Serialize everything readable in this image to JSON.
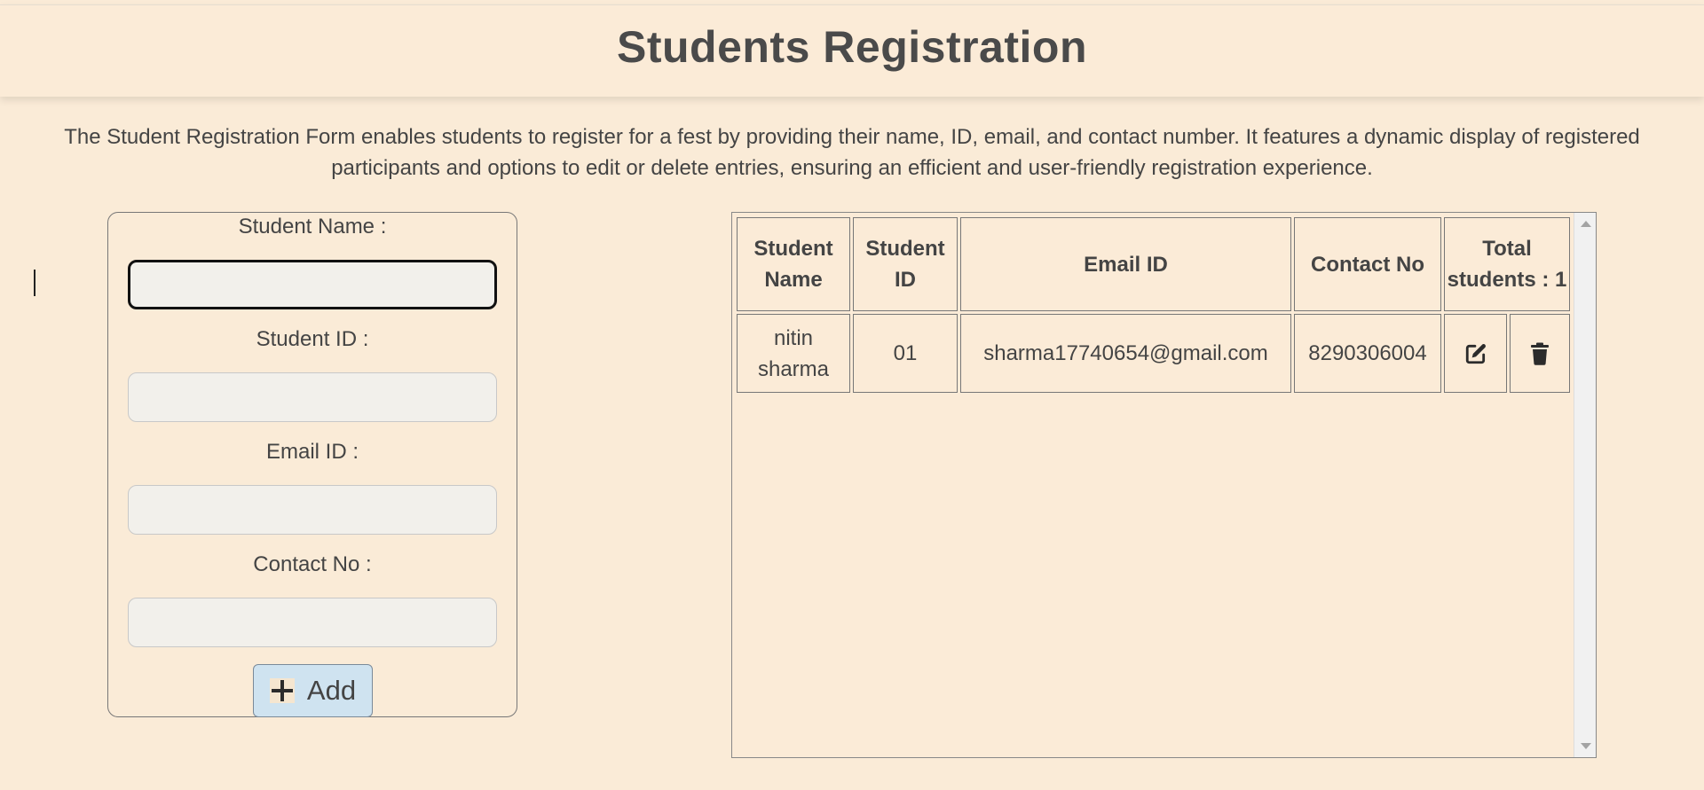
{
  "header": {
    "title": "Students Registration"
  },
  "description": "The Student Registration Form enables students to register for a fest by providing their name, ID, email, and contact number. It features a dynamic display of registered participants and options to edit or delete entries, ensuring an efficient and user-friendly registration experience.",
  "form": {
    "fields": [
      {
        "label": "Student Name :",
        "value": "",
        "placeholder": ""
      },
      {
        "label": "Student ID :",
        "value": "",
        "placeholder": ""
      },
      {
        "label": "Email ID :",
        "value": "",
        "placeholder": ""
      },
      {
        "label": "Contact No :",
        "value": "",
        "placeholder": ""
      }
    ],
    "add_button": {
      "icon": "plus-icon",
      "label": "Add"
    }
  },
  "table": {
    "headers": {
      "name": "Student Name",
      "id": "Student ID",
      "email": "Email ID",
      "contact": "Contact No",
      "total": "Total students : 1"
    },
    "rows": [
      {
        "name": "nitin sharma",
        "id": "01",
        "email": "sharma17740654@gmail.com",
        "contact": "8290306004",
        "edit_icon": "edit-icon",
        "delete_icon": "trash-icon"
      }
    ]
  },
  "colors": {
    "background": "#faebd7",
    "text": "#444444",
    "add_button": "#cfe3f0",
    "input": "#f2f0eb"
  }
}
